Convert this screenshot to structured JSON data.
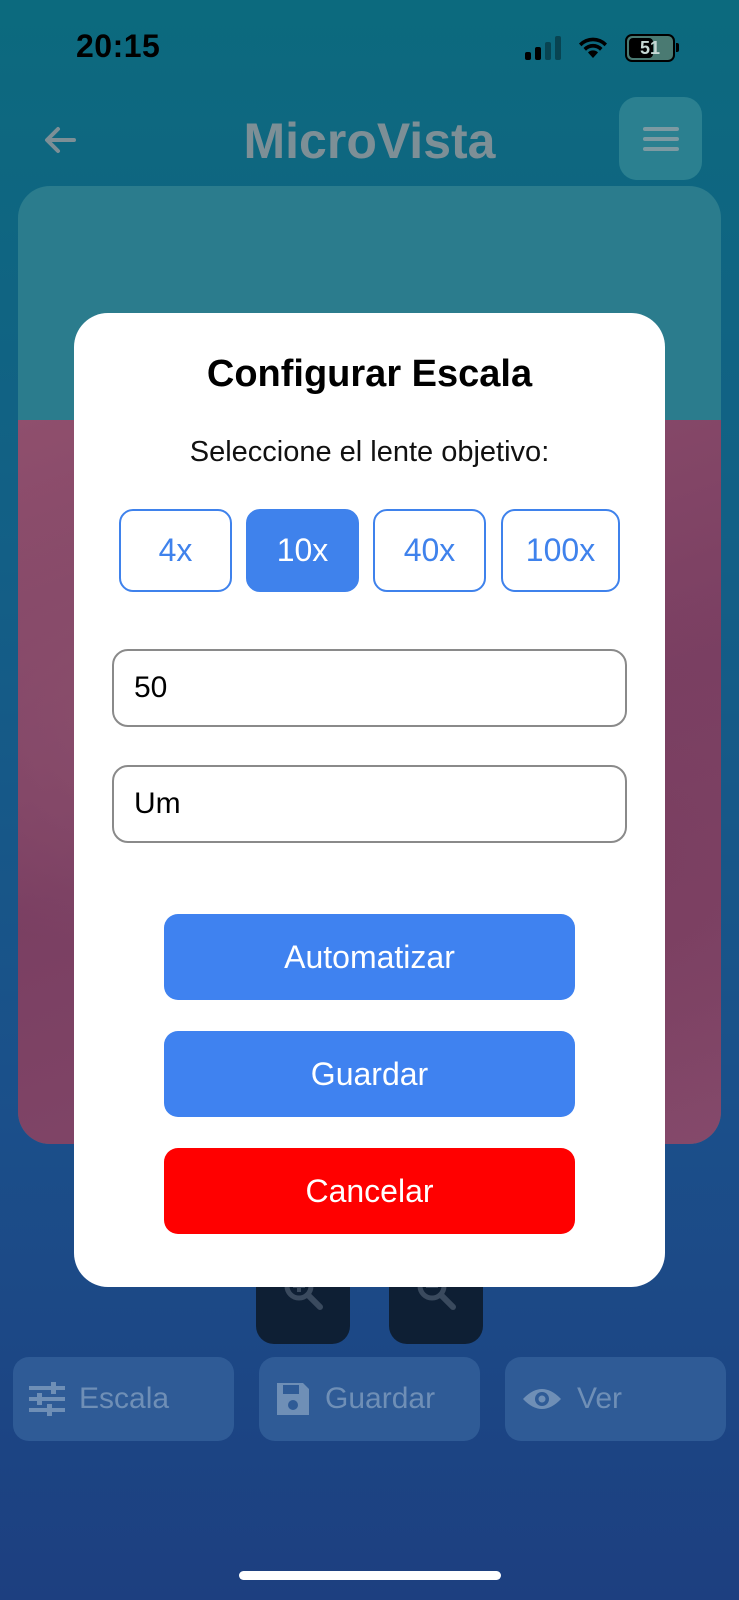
{
  "status_bar": {
    "time": "20:15",
    "battery_level": "51"
  },
  "header": {
    "title": "MicroVista"
  },
  "icons": {
    "back": "arrow-left-icon",
    "menu": "hamburger-menu-icon",
    "zoom_in": "zoom-in-icon",
    "zoom_out": "zoom-out-icon",
    "scale": "sliders-icon",
    "save": "floppy-disk-icon",
    "view": "eye-icon"
  },
  "bottom_bar": {
    "scale_label": "Escala",
    "save_label": "Guardar",
    "view_label": "Ver"
  },
  "modal": {
    "title": "Configurar Escala",
    "subtitle": "Seleccione el lente objetivo:",
    "lenses": [
      {
        "label": "4x",
        "selected": false
      },
      {
        "label": "10x",
        "selected": true
      },
      {
        "label": "40x",
        "selected": false
      },
      {
        "label": "100x",
        "selected": false
      }
    ],
    "value_field": "50",
    "unit_field": "Um",
    "automate_label": "Automatizar",
    "save_label": "Guardar",
    "cancel_label": "Cancelar"
  },
  "colors": {
    "accent": "#3F82F0",
    "danger": "#FF0000",
    "modal_bg": "#FFFFFF"
  }
}
